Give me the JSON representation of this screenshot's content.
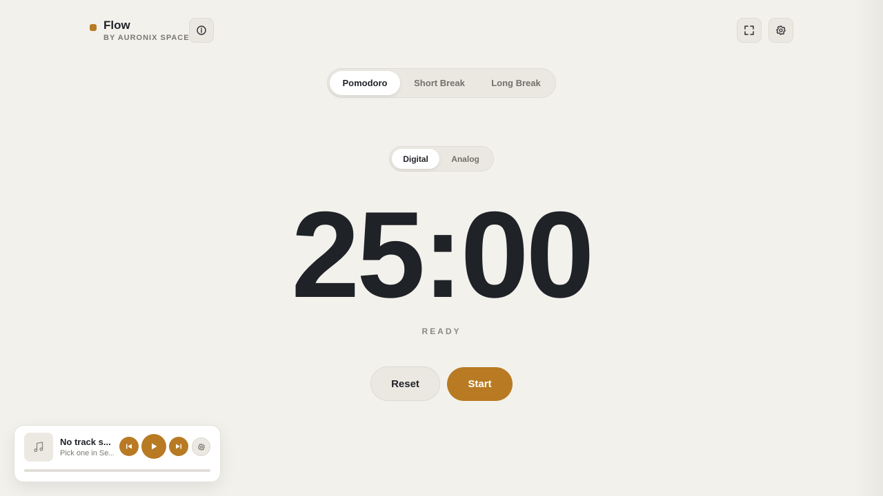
{
  "brand": {
    "title": "Flow",
    "subtitle": "BY AURONIX SPACE",
    "accent_color": "#b87a22"
  },
  "header": {
    "info_icon": "info-icon",
    "fullscreen_icon": "fullscreen-icon",
    "settings_icon": "gear-icon"
  },
  "modes": {
    "selected": "Pomodoro",
    "tabs": [
      {
        "label": "Pomodoro"
      },
      {
        "label": "Short Break"
      },
      {
        "label": "Long Break"
      }
    ]
  },
  "display": {
    "selected": "Digital",
    "tabs": [
      {
        "label": "Digital"
      },
      {
        "label": "Analog"
      }
    ]
  },
  "timer": {
    "time": "25:00",
    "status": "READY"
  },
  "actions": {
    "reset_label": "Reset",
    "start_label": "Start"
  },
  "player": {
    "track_title": "No track s...",
    "track_subtitle": "Pick one in Se...",
    "progress": 0,
    "art_icon": "music-note-icon",
    "prev_icon": "skip-previous-icon",
    "play_icon": "play-icon",
    "next_icon": "skip-next-icon",
    "settings_icon": "gear-icon"
  }
}
